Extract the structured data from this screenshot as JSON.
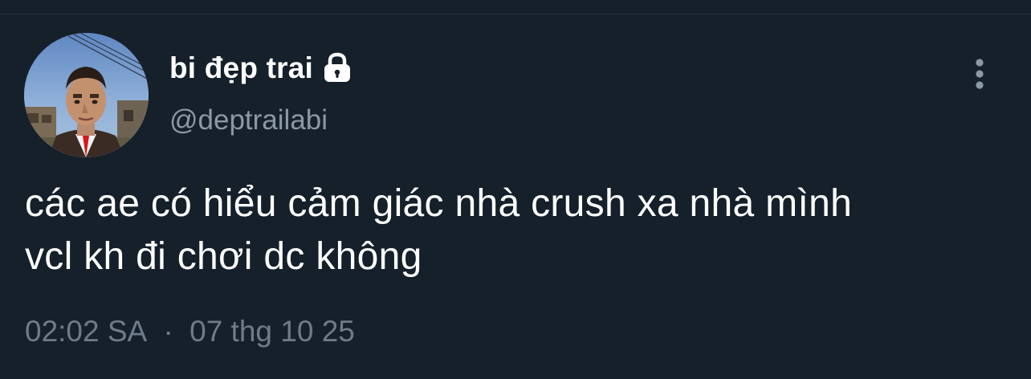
{
  "tweet": {
    "author": {
      "display_name": "bi đẹp trai",
      "handle": "@deptrailabi",
      "protected_icon": "lock-icon",
      "avatar_icon": "profile-photo"
    },
    "more_icon": "more-vertical-icon",
    "text_lines": [
      "các ae có hiểu cảm giác nhà crush xa nhà mình",
      "vcl kh đi chơi dc không"
    ],
    "time": "02:02 SA",
    "separator": "·",
    "date": "07 thg 10 25"
  },
  "colors": {
    "background": "#15202b",
    "primary_text": "#ffffff",
    "secondary_text": "#8b98a5",
    "meta_text": "#6e7c8a",
    "icon": "#8b98a5"
  }
}
